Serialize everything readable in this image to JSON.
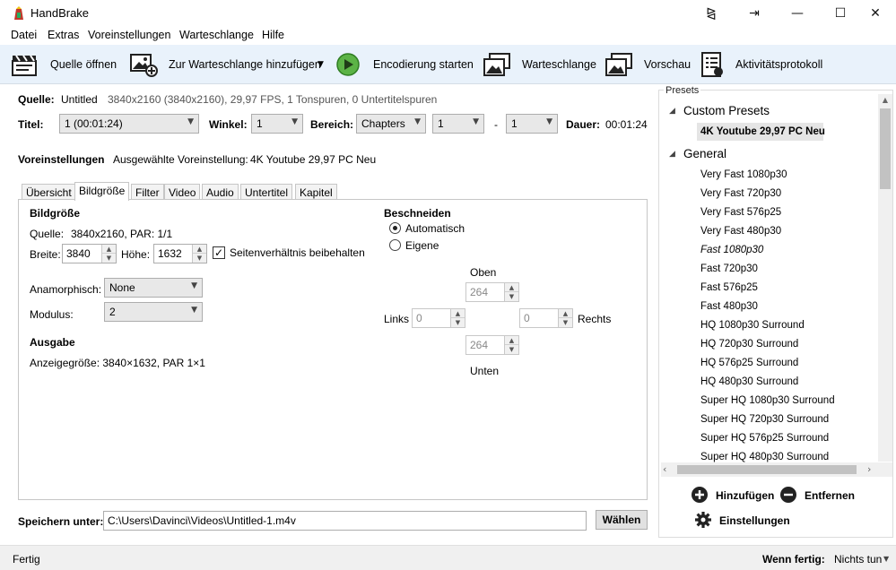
{
  "window": {
    "title": "HandBrake"
  },
  "menu": [
    "Datei",
    "Extras",
    "Voreinstellungen",
    "Warteschlange",
    "Hilfe"
  ],
  "toolbar": {
    "open_source": "Quelle öffnen",
    "add_queue": "Zur Warteschlange hinzufügen",
    "start_encode": "Encodierung starten",
    "queue": "Warteschlange",
    "preview": "Vorschau",
    "activity_log": "Aktivitätsprotokoll"
  },
  "source": {
    "label": "Quelle:",
    "name": "Untitled",
    "info": "3840x2160 (3840x2160), 29,97 FPS, 1 Tonspuren, 0 Untertitelspuren"
  },
  "title_row": {
    "title_label": "Titel:",
    "title_value": "1 (00:01:24)",
    "angle_label": "Winkel:",
    "angle_value": "1",
    "range_label": "Bereich:",
    "range_type": "Chapters",
    "range_start": "1",
    "range_sep": "-",
    "range_end": "1",
    "duration_label": "Dauer:",
    "duration_value": "00:01:24"
  },
  "preset_row": {
    "label": "Voreinstellungen",
    "selected_label": "Ausgewählte Voreinstellung:",
    "selected_value": "4K Youtube 29,97 PC Neu"
  },
  "tabs": [
    "Übersicht",
    "Bildgröße",
    "Filter",
    "Video",
    "Audio",
    "Untertitel",
    "Kapitel"
  ],
  "picture": {
    "heading": "Bildgröße",
    "source_label": "Quelle:",
    "source_value": "3840x2160, PAR: 1/1",
    "width_label": "Breite:",
    "width_value": "3840",
    "height_label": "Höhe:",
    "height_value": "1632",
    "keep_aspect_label": "Seitenverhältnis beibehalten",
    "anamorphic_label": "Anamorphisch:",
    "anamorphic_value": "None",
    "modulus_label": "Modulus:",
    "modulus_value": "2",
    "output_heading": "Ausgabe",
    "display_size": "Anzeigegröße: 3840×1632, PAR 1×1"
  },
  "crop": {
    "heading": "Beschneiden",
    "auto_label": "Automatisch",
    "custom_label": "Eigene",
    "top_label": "Oben",
    "top_value": "264",
    "left_label": "Links",
    "left_value": "0",
    "right_label": "Rechts",
    "right_value": "0",
    "bottom_label": "Unten",
    "bottom_value": "264"
  },
  "save": {
    "label": "Speichern unter:",
    "path": "C:\\Users\\Davinci\\Videos\\Untitled-1.m4v",
    "browse": "Wählen"
  },
  "presets": {
    "title": "Presets",
    "custom_category": "Custom Presets",
    "custom_items": [
      "4K Youtube 29,97 PC Neu"
    ],
    "general_category": "General",
    "general_items": [
      "Very Fast 1080p30",
      "Very Fast 720p30",
      "Very Fast 576p25",
      "Very Fast 480p30",
      "Fast 1080p30",
      "Fast 720p30",
      "Fast 576p25",
      "Fast 480p30",
      "HQ 1080p30 Surround",
      "HQ 720p30 Surround",
      "HQ 576p25 Surround",
      "HQ 480p30 Surround",
      "Super HQ 1080p30 Surround",
      "Super HQ 720p30 Surround",
      "Super HQ 576p25 Surround",
      "Super HQ 480p30 Surround"
    ],
    "add": "Hinzufügen",
    "remove": "Entfernen",
    "settings": "Einstellungen"
  },
  "status": {
    "left": "Fertig",
    "when_done_label": "Wenn fertig:",
    "when_done_value": "Nichts tun"
  }
}
